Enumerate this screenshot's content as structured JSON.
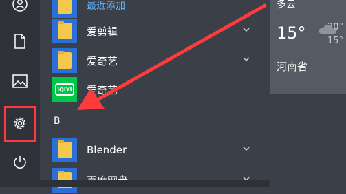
{
  "apps": [
    {
      "label": "最近添加",
      "accent": true
    },
    {
      "label": "爱剪辑"
    },
    {
      "label": "爱奇艺"
    },
    {
      "label": "爱奇艺",
      "icon_name": "iqiyi-icon",
      "icon_text": "iQIYI"
    },
    {
      "label": "Blender"
    },
    {
      "label": "百度网盘"
    }
  ],
  "section_letter": "B",
  "weather": {
    "condition": "多云",
    "temperature": "15°",
    "high": "20°",
    "low": "15°",
    "location": "河南省"
  },
  "rail_icons": [
    "user-icon",
    "document-icon",
    "pictures-icon",
    "gear-icon",
    "power-icon"
  ],
  "colors": {
    "tile": "#2c6fd6",
    "accent_text": "#5fb4ff",
    "annotation": "#ff3b3b",
    "iqiyi": "#00c846"
  }
}
